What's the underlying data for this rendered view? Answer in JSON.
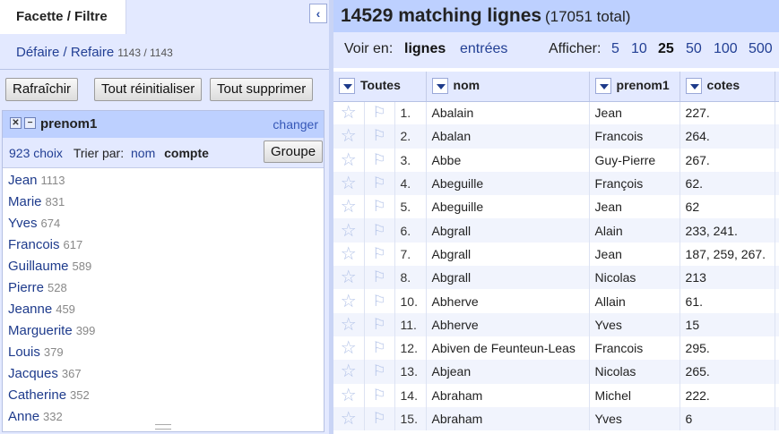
{
  "left": {
    "tab_title": "Facette / Filtre",
    "collapse_glyph": "‹",
    "undo_label": "Défaire / Refaire",
    "undo_count": "1143 / 1143",
    "refresh_label": "Rafraîchir",
    "reset_all_label": "Tout réinitialiser",
    "remove_all_label": "Tout supprimer",
    "facet": {
      "title": "prenom1",
      "change_label": "changer",
      "choices_count": "923 choix",
      "sort_label": "Trier par:",
      "sort_name": "nom",
      "sort_count": "compte",
      "group_label": "Groupe",
      "choices": [
        {
          "name": "Jean",
          "count": "1113"
        },
        {
          "name": "Marie",
          "count": "831"
        },
        {
          "name": "Yves",
          "count": "674"
        },
        {
          "name": "Francois",
          "count": "617"
        },
        {
          "name": "Guillaume",
          "count": "589"
        },
        {
          "name": "Pierre",
          "count": "528"
        },
        {
          "name": "Jeanne",
          "count": "459"
        },
        {
          "name": "Marguerite",
          "count": "399"
        },
        {
          "name": "Louis",
          "count": "379"
        },
        {
          "name": "Jacques",
          "count": "367"
        },
        {
          "name": "Catherine",
          "count": "352"
        },
        {
          "name": "Anne",
          "count": "332"
        }
      ]
    }
  },
  "right": {
    "matching": "14529 matching lignes",
    "total": "(17051 total)",
    "view_label": "Voir en:",
    "view_rows": "lignes",
    "view_records": "entrées",
    "show_label": "Afficher:",
    "page_sizes": [
      "5",
      "10",
      "25",
      "50",
      "100",
      "500"
    ],
    "selected_page_size": "25",
    "columns": [
      "Toutes",
      "nom",
      "prenom1",
      "cotes"
    ],
    "rows": [
      {
        "n": "1.",
        "nom": "Abalain",
        "prenom1": "Jean",
        "cotes": "227."
      },
      {
        "n": "2.",
        "nom": "Abalan",
        "prenom1": "Francois",
        "cotes": "264."
      },
      {
        "n": "3.",
        "nom": "Abbe",
        "prenom1": "Guy-Pierre",
        "cotes": "267."
      },
      {
        "n": "4.",
        "nom": "Abeguille",
        "prenom1": "François",
        "cotes": "62."
      },
      {
        "n": "5.",
        "nom": "Abeguille",
        "prenom1": "Jean",
        "cotes": "62"
      },
      {
        "n": "6.",
        "nom": "Abgrall",
        "prenom1": "Alain",
        "cotes": "233, 241."
      },
      {
        "n": "7.",
        "nom": "Abgrall",
        "prenom1": "Jean",
        "cotes": "187, 259, 267."
      },
      {
        "n": "8.",
        "nom": "Abgrall",
        "prenom1": "Nicolas",
        "cotes": "213"
      },
      {
        "n": "10.",
        "nom": "Abherve",
        "prenom1": "Allain",
        "cotes": "61."
      },
      {
        "n": "11.",
        "nom": "Abherve",
        "prenom1": "Yves",
        "cotes": "15"
      },
      {
        "n": "12.",
        "nom": "Abiven de Feunteun-Leas",
        "prenom1": "Francois",
        "cotes": "295."
      },
      {
        "n": "13.",
        "nom": "Abjean",
        "prenom1": "Nicolas",
        "cotes": "265."
      },
      {
        "n": "14.",
        "nom": "Abraham",
        "prenom1": "Michel",
        "cotes": "222."
      },
      {
        "n": "15.",
        "nom": "Abraham",
        "prenom1": "Yves",
        "cotes": "6"
      }
    ]
  },
  "icons": {
    "star": "star-icon",
    "flag": "flag-icon",
    "remove": "close-icon",
    "minimize": "minus-icon",
    "dropdown": "dropdown-arrow-icon"
  },
  "colors": {
    "header_blue": "#bdd0ff",
    "panel_blue": "#e3e9ff",
    "link": "#223f94"
  }
}
